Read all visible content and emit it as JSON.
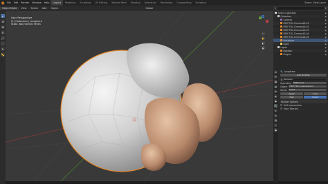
{
  "topbar": {
    "logo_icon": "blender-logo-icon",
    "menu": [
      "File",
      "Edit",
      "Render",
      "Window",
      "Help"
    ],
    "workspaces": [
      "Layout",
      "Modeling",
      "Sculpting",
      "UV Editing",
      "Texture Paint",
      "Shading",
      "Animation",
      "Rendering",
      "Compositing",
      "Scripting"
    ],
    "active_workspace": "Layout",
    "scene_label": "Scene",
    "layer_label": "View Layer"
  },
  "header": {
    "mode": "Object Mode",
    "menus": [
      "View",
      "Select",
      "Add",
      "Object"
    ],
    "orientation": "Global"
  },
  "viewport": {
    "overlay_lines": [
      "User Perspective",
      "(1) Collection | Icosphere",
      "Stats: Barycentric Mesh"
    ],
    "gizmo_axes": {
      "x": "X",
      "y": "Y",
      "z": "Z"
    },
    "colors": {
      "x": "#e0424f",
      "y": "#74b341",
      "z": "#3d80cc",
      "selection": "#e48a2c"
    }
  },
  "outliner": {
    "title": "Scene Collection",
    "rows": [
      {
        "label": "Scene Collection",
        "icon_color": "#cfcfcf",
        "indent": 0
      },
      {
        "label": "Collection",
        "icon_color": "#cfcfcf",
        "indent": 1
      },
      {
        "label": "Camera",
        "icon_color": "#8d6bb8",
        "indent": 2
      },
      {
        "label": "FBFF.TB1.Cinema4D.01",
        "icon_color": "#e48a2c",
        "indent": 2
      },
      {
        "label": "FBFF.TB1.Cinema4D.02",
        "icon_color": "#e48a2c",
        "indent": 2
      },
      {
        "label": "FBFF.TB1.Cinema4D.03",
        "icon_color": "#e48a2c",
        "indent": 2
      },
      {
        "label": "FBFF.TB1.Cinema4D.04",
        "icon_color": "#e48a2c",
        "indent": 2
      },
      {
        "label": "FBFF.TB1.Cinema4D.05",
        "icon_color": "#e48a2c",
        "indent": 2
      },
      {
        "label": "Icosphere",
        "icon_color": "#e48a2c",
        "indent": 2,
        "selected": true
      },
      {
        "label": "Light",
        "icon_color": "#e8d35c",
        "indent": 2
      },
      {
        "label": "Lights",
        "icon_color": "#cfcfcf",
        "indent": 1
      },
      {
        "label": "Boolean",
        "icon_color": "#e48a2c",
        "indent": 2
      },
      {
        "label": "Origins",
        "icon_color": "#e48a2c",
        "indent": 2
      }
    ]
  },
  "properties": {
    "tabs": [
      "tool-icon",
      "render-icon",
      "output-icon",
      "view-layer-icon",
      "scene-icon",
      "world-icon",
      "object-icon",
      "modifier-icon",
      "particles-icon",
      "physics-icon",
      "constraints-icon",
      "data-icon",
      "material-icon"
    ],
    "object_name": "Icosphere",
    "modifier_header": "Add Modifier",
    "modifier_name": "Boolean",
    "fields": [
      {
        "label": "Operation",
        "value": "Difference"
      },
      {
        "label": "Object",
        "value": "FBFF.TB1.Cinema4D.01"
      },
      {
        "label": "Solver",
        "value": "Exact"
      }
    ],
    "buttons": {
      "apply": "Apply",
      "copy": "Copy",
      "fast": "Fast",
      "exact": "Exact"
    },
    "options_title": "Solver Options",
    "options": [
      "Self Intersection",
      "Hole Tolerant"
    ]
  }
}
